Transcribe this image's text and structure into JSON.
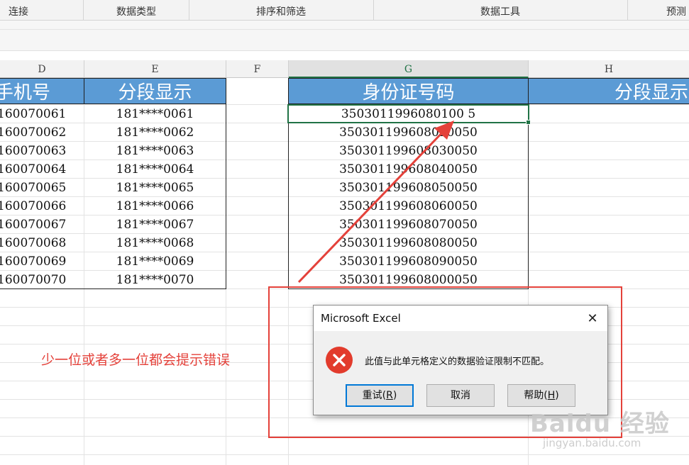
{
  "ribbon": {
    "groups": [
      "连接",
      "数据类型",
      "排序和筛选",
      "数据工具",
      "预测"
    ]
  },
  "columns": {
    "D": "D",
    "E": "E",
    "F": "F",
    "G": "G",
    "H": "H"
  },
  "table1": {
    "header_phone": "手机号",
    "header_segment": "分段显示",
    "rows": [
      {
        "phone": "160070061",
        "segment": "181****0061"
      },
      {
        "phone": "160070062",
        "segment": "181****0062"
      },
      {
        "phone": "160070063",
        "segment": "181****0063"
      },
      {
        "phone": "160070064",
        "segment": "181****0064"
      },
      {
        "phone": "160070065",
        "segment": "181****0065"
      },
      {
        "phone": "160070066",
        "segment": "181****0066"
      },
      {
        "phone": "160070067",
        "segment": "181****0067"
      },
      {
        "phone": "160070068",
        "segment": "181****0068"
      },
      {
        "phone": "160070069",
        "segment": "181****0069"
      },
      {
        "phone": "160070070",
        "segment": "181****0070"
      }
    ]
  },
  "table2": {
    "header_id": "身份证号码",
    "header_segment": "分段显示",
    "ids": [
      "3503011996080100 5",
      "350301199608020050",
      "350301199608030050",
      "350301199608040050",
      "350301199608050050",
      "350301199608060050",
      "350301199608070050",
      "350301199608080050",
      "350301199608090050",
      "350301199608000050"
    ]
  },
  "annotation": {
    "note": "少一位或者多一位都会提示错误",
    "color": "#e4413a"
  },
  "dialog": {
    "title": "Microsoft Excel",
    "close_glyph": "✕",
    "message": "此值与此单元格定义的数据验证限制不匹配。",
    "icon": "error-x-icon",
    "retry_label": "重试(",
    "retry_key": "R",
    "retry_suffix": ")",
    "cancel_label": "取消",
    "help_label": "帮助(",
    "help_key": "H",
    "help_suffix": ")"
  },
  "watermark": {
    "brand": "Baidu 经验",
    "url": "jingyan.baidu.com"
  },
  "colors": {
    "header_fill": "#5b9bd5",
    "excel_green": "#217346",
    "error_red": "#e23b2c"
  }
}
